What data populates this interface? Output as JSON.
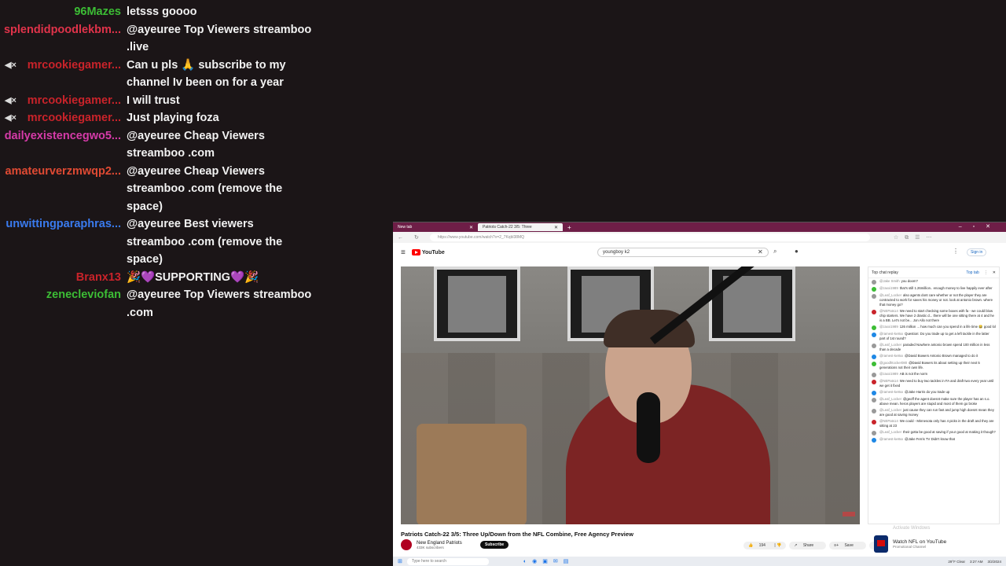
{
  "chat": {
    "messages": [
      {
        "user": "96Mazes",
        "color": "#3cbd35",
        "text": "letsss goooo",
        "muted": false
      },
      {
        "user": "splendidpoodlekbm...",
        "color": "#e0334a",
        "text": "@ayeuree Top Viewers streamboo .live",
        "muted": false
      },
      {
        "user": "mrcookiegamer...",
        "color": "#c9232a",
        "text": "Can u pls 🙏 subscribe to my channel Iv been on for a year",
        "muted": true
      },
      {
        "user": "mrcookiegamer...",
        "color": "#c9232a",
        "text": "I will trust",
        "muted": true
      },
      {
        "user": "mrcookiegamer...",
        "color": "#c9232a",
        "text": "Just playing foza",
        "muted": true
      },
      {
        "user": "dailyexistencegwo5...",
        "color": "#d63ba9",
        "text": "@ayeuree Cheap Viewers streamboo .com",
        "muted": false
      },
      {
        "user": "amateurverzmwqp2...",
        "color": "#e04a33",
        "text": "@ayeuree Cheap Viewers streamboo .com (remove the space)",
        "muted": false
      },
      {
        "user": "unwittingparaphras...",
        "color": "#3a7bef",
        "text": "@ayeuree Best viewers streamboo .com (remove the space)",
        "muted": false
      },
      {
        "user": "Branx13",
        "color": "#c9232a",
        "text": "🎉💜SUPPORTING💜🎉",
        "muted": false
      },
      {
        "user": "zenecleviofan",
        "color": "#3cbd35",
        "text": "@ayeuree Top Viewers streamboo .com",
        "muted": false
      }
    ]
  },
  "browser": {
    "tab1": "New tab",
    "tab2": "Patriots Catch-22 3/5: Three",
    "url": "https://www.youtube.com/watch?v=2_7Kqbl38MQ",
    "search_query": "youngboy k2",
    "logo_text": "YouTube",
    "signin": "Sign in"
  },
  "video": {
    "title": "Patriots Catch-22 3/5: Three Up/Down from the NFL Combine, Free Agency Preview",
    "channel": "New England Patriots",
    "subscribers": "433K subscribers",
    "subscribe_label": "Subscribe",
    "likes": "194",
    "share_label": "Share",
    "save_label": "Save"
  },
  "livechat": {
    "header": "Top chat replay",
    "toggle": "Top tab",
    "messages": [
      {
        "user": "@Jake Smith",
        "text": "you doom?",
        "color": "#999999"
      },
      {
        "user": "@zaxxi1989",
        "text": "that's still 1.26million.. enough money to live happily ever after",
        "color": "#3cbd35"
      },
      {
        "user": "@Leaf_Locker",
        "text": "also agents dont care whether or not the player they are contracted to work for saves his money or not. look at antonio brown. where that money go?",
        "color": "#999999"
      },
      {
        "user": "@NEPats14",
        "text": "We need to start checking some boxes with fa - we could blow chip starters. We have 2 drastic d... there will be one sitting there at 4 and he is a BB. Let's not be... Jon Allo not there",
        "color": "#c9232a"
      },
      {
        "user": "@zaxxi1989",
        "text": "126 million ... how much can you spend in a life time 😂 good lol",
        "color": "#3cbd35"
      },
      {
        "user": "@ramest-ke8xx",
        "text": "Question: Do you trade up to get a left tackle in the latter part of 1st round?",
        "color": "#1e88e5"
      },
      {
        "user": "@Leaf_Locker",
        "text": "paraded Nowhere antonio brown spend 100 million in less than a decade",
        "color": "#999999"
      },
      {
        "user": "@ramest-ke8xx",
        "text": "@David Bowers Antonio Brown managed to do it",
        "color": "#1e88e5"
      },
      {
        "user": "@goodhtocker080",
        "text": "@David Bowers its about setting up their next 5 generations not their own life.",
        "color": "#3cbd35"
      },
      {
        "user": "@zaxxi1989",
        "text": "AB is not the norm",
        "color": "#999999"
      },
      {
        "user": "@NEPats14",
        "text": "We need to buy two tackles in FA and draft two every year until we get it fixed",
        "color": "#c9232a"
      },
      {
        "user": "@ramest-ke8xx",
        "text": "@Jake Harris do you trade up",
        "color": "#1e88e5"
      },
      {
        "user": "@Leaf_Locker",
        "text": "@geoff the agent doesnt make sure the player has an s.o. above mean. heros players are stupid and most of them go broke",
        "color": "#999999"
      },
      {
        "user": "@Leaf_Locker",
        "text": "just cause they can run fast and jump high doesnt mean they are good at saving money",
        "color": "#999999"
      },
      {
        "user": "@NEPats14",
        "text": "We could - Minnesota only has 4 picks in the draft and they are sitting at 23",
        "color": "#c9232a"
      },
      {
        "user": "@Leaf_Locker",
        "text": "their gotta be good at saving if your good at making it though?",
        "color": "#999999"
      },
      {
        "user": "@ramest-ke8xx",
        "text": "@Jake Ferris TV Didn't know that",
        "color": "#1e88e5"
      }
    ]
  },
  "promo": {
    "title": "Watch NFL on YouTube",
    "subtitle": "Promotional Channel",
    "activate": "Activate Windows"
  },
  "taskbar": {
    "search_placeholder": "Type here to search",
    "weather": "29°F Clear",
    "time": "3:27 AM",
    "date": "3/2/2024"
  }
}
